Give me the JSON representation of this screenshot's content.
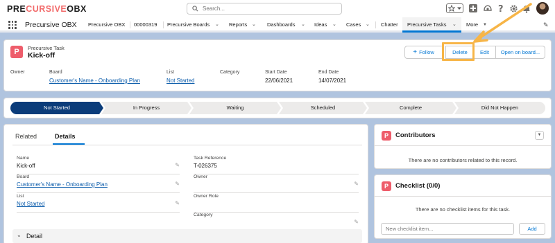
{
  "header": {
    "logo_main": "PRECURSIVE",
    "logo_accent_start": "PRE",
    "logo_accent": "CURSIVE",
    "logo_suffix": "OBX",
    "search_placeholder": "Search..."
  },
  "nav": {
    "app_name": "Precursive OBX",
    "items": [
      {
        "label": "Precursive OBX",
        "chevron": false
      },
      {
        "label": "00000319",
        "chevron": false
      },
      {
        "label": "Precursive Boards",
        "chevron": true
      },
      {
        "label": "Reports",
        "chevron": true
      },
      {
        "label": "Dashboards",
        "chevron": true
      },
      {
        "label": "Ideas",
        "chevron": true
      },
      {
        "label": "Cases",
        "chevron": true
      },
      {
        "label": "Chatter",
        "chevron": false
      },
      {
        "label": "Precursive Tasks",
        "chevron": true
      },
      {
        "label": "More",
        "chevron": true
      }
    ],
    "active_item": "Precursive Tasks"
  },
  "record": {
    "type": "Precursive Task",
    "title": "Kick-off",
    "buttons": {
      "follow": "Follow",
      "delete": "Delete",
      "edit": "Edit",
      "open_board": "Open on board..."
    },
    "fields": {
      "owner_label": "Owner",
      "board_label": "Board",
      "board_value": "Customer's Name - Onboarding Plan",
      "list_label": "List",
      "list_value": "Not Started",
      "category_label": "Category",
      "start_label": "Start Date",
      "start_value": "22/06/2021",
      "end_label": "End Date",
      "end_value": "14/07/2021"
    }
  },
  "path": {
    "steps": [
      "Not Started",
      "In Progress",
      "Waiting",
      "Scheduled",
      "Complete",
      "Did Not Happen"
    ],
    "current": "Not Started"
  },
  "details": {
    "tabs": [
      "Related",
      "Details"
    ],
    "active_tab": "Details",
    "left_fields": [
      {
        "label": "Name",
        "value": "Kick-off",
        "link": false
      },
      {
        "label": "Board",
        "value": "Customer's Name - Onboarding Plan",
        "link": true
      },
      {
        "label": "List",
        "value": "Not Started",
        "link": true
      }
    ],
    "right_fields": [
      {
        "label": "Task Reference",
        "value": "T-026375"
      },
      {
        "label": "Owner",
        "value": ""
      },
      {
        "label": "Owner Role",
        "value": ""
      },
      {
        "label": "Category",
        "value": ""
      }
    ],
    "section_label": "Detail"
  },
  "contributors": {
    "title": "Contributors",
    "empty_text": "There are no contributors related to this record."
  },
  "checklist": {
    "title": "Checklist (0/0)",
    "empty_text": "There are no checklist items for this task.",
    "input_placeholder": "New checklist item...",
    "add_label": "Add"
  },
  "colors": {
    "accent": "#0176d3",
    "brand_icon": "#ee5d6b",
    "path_current": "#0b3c7a",
    "highlight": "#f7b547"
  }
}
